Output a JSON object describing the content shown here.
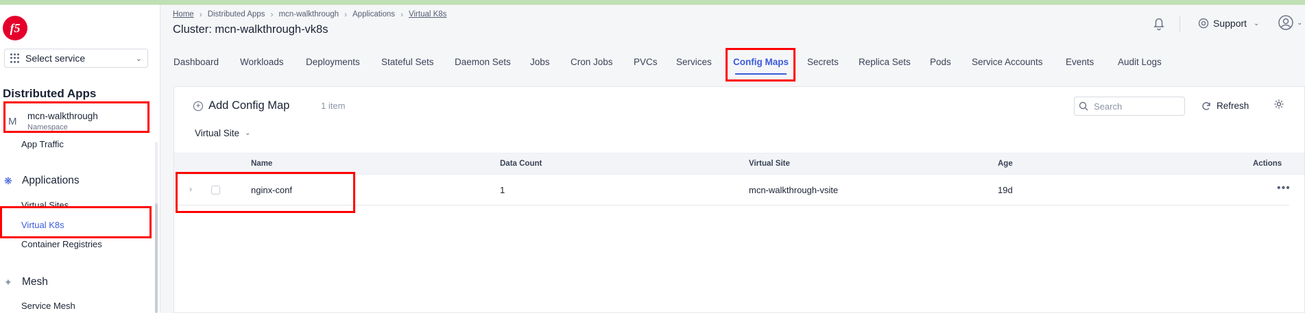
{
  "brand": {
    "logo_text": "f5"
  },
  "sidebar": {
    "service_selector": "Select service",
    "section_title": "Distributed Apps",
    "namespace": {
      "initial": "M",
      "name": "mcn-walkthrough",
      "label": "Namespace"
    },
    "items": {
      "app_traffic": "App Traffic",
      "applications_group": "Applications",
      "virtual_sites": "Virtual Sites",
      "virtual_k8s": "Virtual K8s",
      "container_registries": "Container Registries",
      "mesh_group": "Mesh",
      "service_mesh": "Service Mesh"
    }
  },
  "header": {
    "breadcrumbs": [
      "Home",
      "Distributed Apps",
      "mcn-walkthrough",
      "Applications",
      "Virtual K8s"
    ],
    "cluster_title": "Cluster: mcn-walkthrough-vk8s",
    "support_label": "Support"
  },
  "tabs": [
    "Dashboard",
    "Workloads",
    "Deployments",
    "Stateful Sets",
    "Daemon Sets",
    "Jobs",
    "Cron Jobs",
    "PVCs",
    "Services",
    "Config Maps",
    "Secrets",
    "Replica Sets",
    "Pods",
    "Service Accounts",
    "Events",
    "Audit Logs"
  ],
  "active_tab": "Config Maps",
  "toolbar": {
    "add_label": "Add Config Map",
    "item_count": "1 item",
    "search_placeholder": "Search",
    "refresh_label": "Refresh",
    "filter_label": "Virtual Site"
  },
  "table": {
    "columns": [
      "Name",
      "Data Count",
      "Virtual Site",
      "Age",
      "Actions"
    ],
    "rows": [
      {
        "name": "nginx-conf",
        "data_count": "1",
        "virtual_site": "mcn-walkthrough-vsite",
        "age": "19d"
      }
    ]
  },
  "colors": {
    "accent": "#3b5bdb",
    "brand": "#e4002b",
    "highlight": "#ff0000"
  },
  "icons": [
    "f5-logo",
    "grid-icon",
    "chevron-down-icon",
    "kubernetes-icon",
    "mesh-icon",
    "bell-icon",
    "support-icon",
    "user-icon",
    "plus-circle-icon",
    "search-icon",
    "refresh-icon",
    "gear-icon",
    "chevron-right-icon",
    "more-horizontal-icon"
  ]
}
